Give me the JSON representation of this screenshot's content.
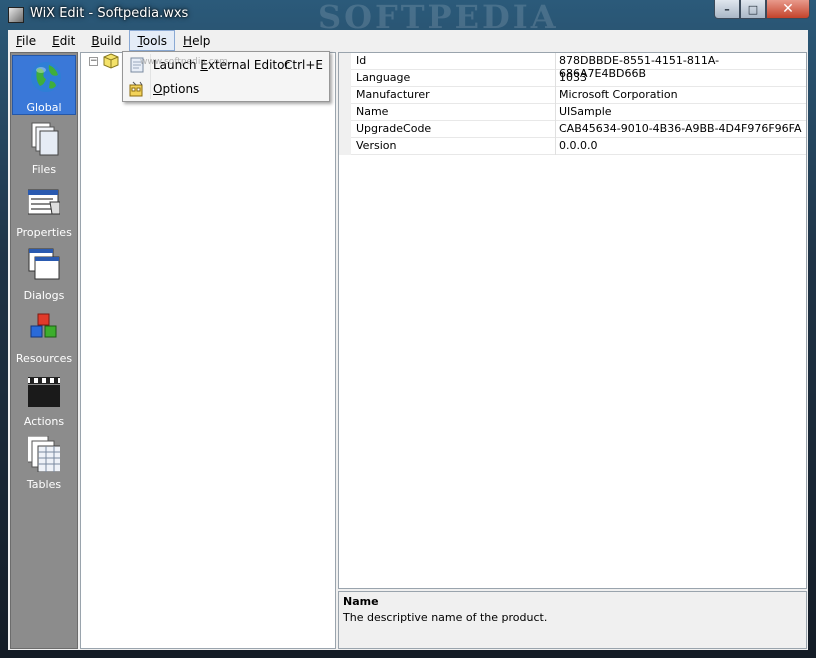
{
  "window": {
    "title": "WiX Edit - Softpedia.wxs",
    "watermark": "SOFTPEDIA",
    "caption_buttons": {
      "minimize": "–",
      "maximize": "□",
      "close": "✕"
    }
  },
  "menubar": {
    "items": [
      {
        "label": "File",
        "mnemonic": "F",
        "rest": "ile"
      },
      {
        "label": "Edit",
        "mnemonic": "E",
        "rest": "dit"
      },
      {
        "label": "Build",
        "mnemonic": "B",
        "rest": "uild"
      },
      {
        "label": "Tools",
        "mnemonic": "T",
        "rest": "ools"
      },
      {
        "label": "Help",
        "mnemonic": "H",
        "rest": "elp"
      }
    ]
  },
  "tools_menu": {
    "items": [
      {
        "label_pre": "Launch ",
        "mnemonic": "E",
        "label_post": "xternal Editor",
        "shortcut": "Ctrl+E",
        "icon": "document-icon"
      },
      {
        "label_pre": "",
        "mnemonic": "O",
        "label_post": "ptions",
        "shortcut": "",
        "icon": "options-icon"
      }
    ],
    "watermark": "www.softpedia.com"
  },
  "sidebar": {
    "items": [
      {
        "label": "Global",
        "icon": "globe-icon",
        "selected": true
      },
      {
        "label": "Files",
        "icon": "files-icon",
        "selected": false
      },
      {
        "label": "Properties",
        "icon": "properties-icon",
        "selected": false
      },
      {
        "label": "Dialogs",
        "icon": "dialogs-icon",
        "selected": false
      },
      {
        "label": "Resources",
        "icon": "resources-icon",
        "selected": false
      },
      {
        "label": "Actions",
        "icon": "clapperboard-icon",
        "selected": false
      },
      {
        "label": "Tables",
        "icon": "tables-icon",
        "selected": false
      }
    ]
  },
  "tree": {
    "expander": "−"
  },
  "properties": {
    "rows": [
      {
        "name": "Id",
        "value": "878DBBDE-8551-4151-811A-686A7E4BD66B"
      },
      {
        "name": "Language",
        "value": "1033"
      },
      {
        "name": "Manufacturer",
        "value": "Microsoft Corporation"
      },
      {
        "name": "Name",
        "value": "UISample"
      },
      {
        "name": "UpgradeCode",
        "value": "CAB45634-9010-4B36-A9BB-4D4F976F96FA"
      },
      {
        "name": "Version",
        "value": "0.0.0.0"
      }
    ]
  },
  "description": {
    "title": "Name",
    "text": "The descriptive name of the product."
  },
  "colors": {
    "sidebar_bg": "#8c8c8c",
    "sidebar_selected": "#3a78d8",
    "close_button": "#c4432b"
  }
}
